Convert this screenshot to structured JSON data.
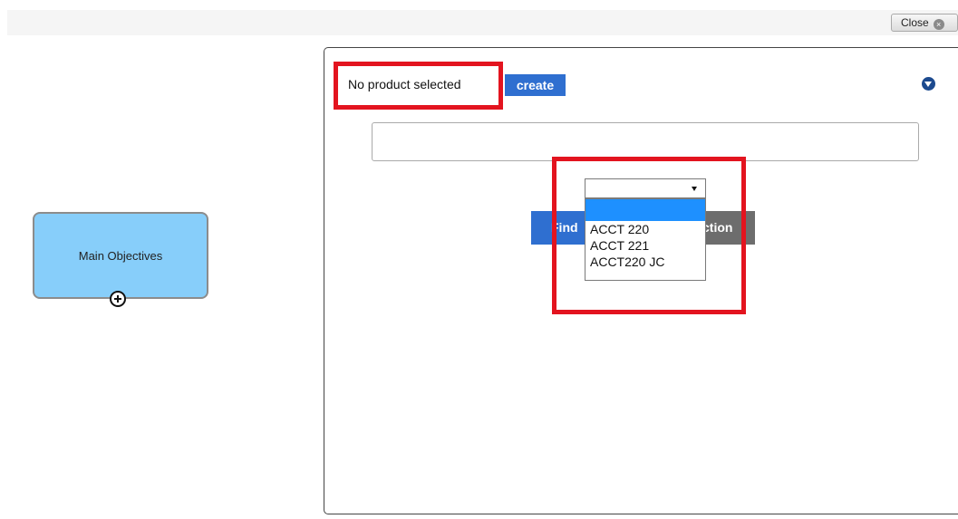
{
  "header": {
    "close_label": "Close"
  },
  "diagram": {
    "node_label": "Main Objectives",
    "add_icon": "plus-circle-icon"
  },
  "panel": {
    "status_text": "No product selected",
    "create_label": "create",
    "collapse_icon": "chevron-down-circle-icon",
    "input_value": "",
    "button_left_label": "Find",
    "button_right_label": "ction"
  },
  "dropdown": {
    "selected_value": "",
    "options": [
      "",
      "ACCT 220",
      "ACCT 221",
      "ACCT220 JC"
    ]
  },
  "colors": {
    "accent_blue": "#2f6fd0",
    "node_fill": "#87cefa",
    "highlight_red": "#e3141f",
    "selected_option": "#1e90ff"
  }
}
